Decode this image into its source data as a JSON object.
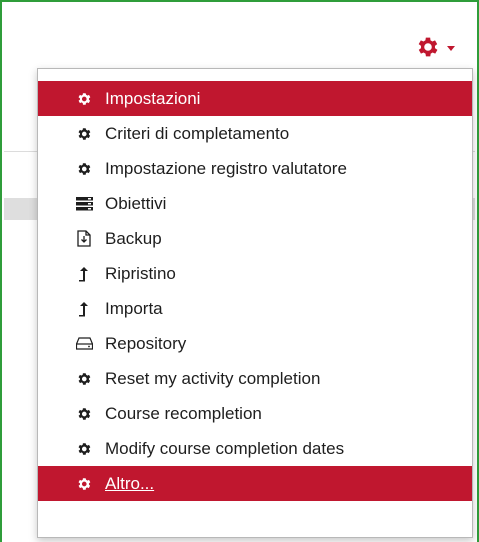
{
  "toolbar": {
    "gear_menu_icon": "gear-icon",
    "caret_icon": "caret-down-icon"
  },
  "menu": {
    "items": [
      {
        "label": "Impostazioni",
        "icon": "gear-icon",
        "active": true
      },
      {
        "label": "Criteri di completamento",
        "icon": "gear-icon"
      },
      {
        "label": "Impostazione registro valutatore",
        "icon": "gear-icon"
      },
      {
        "label": "Obiettivi",
        "icon": "server-icon"
      },
      {
        "label": "Backup",
        "icon": "file-download-icon"
      },
      {
        "label": "Ripristino",
        "icon": "upload-arrow-icon"
      },
      {
        "label": "Importa",
        "icon": "upload-arrow-icon"
      },
      {
        "label": "Repository",
        "icon": "drive-icon"
      },
      {
        "label": "Reset my activity completion",
        "icon": "gear-icon"
      },
      {
        "label": "Course recompletion",
        "icon": "gear-icon"
      },
      {
        "label": "Modify course completion dates",
        "icon": "gear-icon"
      },
      {
        "label": "Altro...",
        "icon": "gear-icon",
        "active": true
      }
    ]
  },
  "colors": {
    "accent": "#c0172f",
    "frame_border": "#2f9d3a",
    "text": "#1e1e1e"
  }
}
